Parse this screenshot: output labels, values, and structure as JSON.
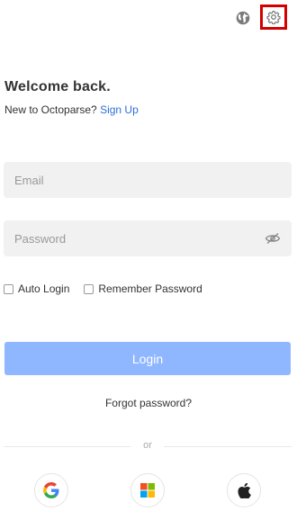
{
  "header": {
    "language_icon": "globe-icon",
    "settings_icon": "gear-icon",
    "highlight_color": "#d40000"
  },
  "intro": {
    "title": "Welcome back.",
    "new_to_text": "New to Octoparse?",
    "signup_link": "Sign Up"
  },
  "form": {
    "email_placeholder": "Email",
    "email_value": "",
    "password_placeholder": "Password",
    "password_value": "",
    "password_toggle_icon": "eye-slash-icon",
    "auto_login_label": "Auto Login",
    "auto_login_checked": false,
    "remember_label": "Remember Password",
    "remember_checked": false,
    "login_button": "Login",
    "login_button_color": "#8fb7ff",
    "forgot_link": "Forgot password?"
  },
  "divider": {
    "label": "or"
  },
  "social": [
    {
      "name": "Google",
      "icon": "google-icon"
    },
    {
      "name": "Microsoft",
      "icon": "microsoft-icon"
    },
    {
      "name": "Apple",
      "icon": "apple-icon"
    }
  ],
  "colors": {
    "link": "#2f6fd6",
    "field_bg": "#f1f1f1"
  }
}
